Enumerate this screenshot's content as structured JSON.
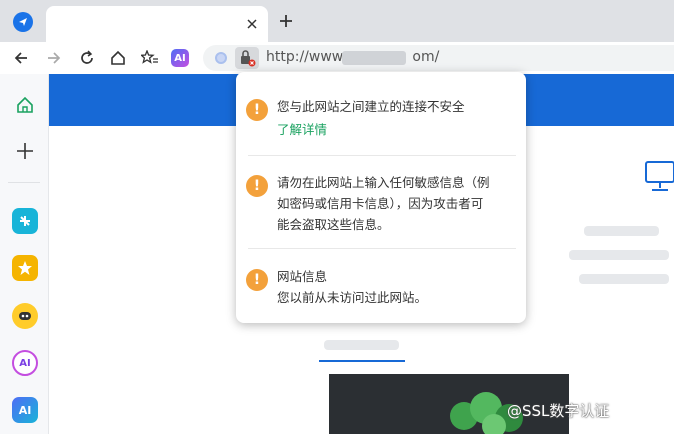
{
  "tab": {
    "title": "",
    "close_icon": "close-icon",
    "new_tab_icon": "plus-icon"
  },
  "toolbar": {
    "ai_label": "AI",
    "url": "http://www.",
    "url_suffix": "om/"
  },
  "sidebar": {
    "ai_label": "AI"
  },
  "security_popup": {
    "items": [
      {
        "text": "您与此网站之间建立的连接不安全",
        "link": "了解详情"
      },
      {
        "lines": [
          "请勿在此网站上输入任何敏感信息（例",
          "如密码或信用卡信息），因为攻击者可",
          "能会盗取这些信息。"
        ]
      },
      {
        "title": "网站信息",
        "text": "您以前从未访问过此网站。"
      }
    ]
  },
  "page": {
    "watermark": "@SSL数字认证"
  },
  "colors": {
    "banner": "#1769d6",
    "warning": "#f3a13b",
    "link": "#1aa260"
  }
}
